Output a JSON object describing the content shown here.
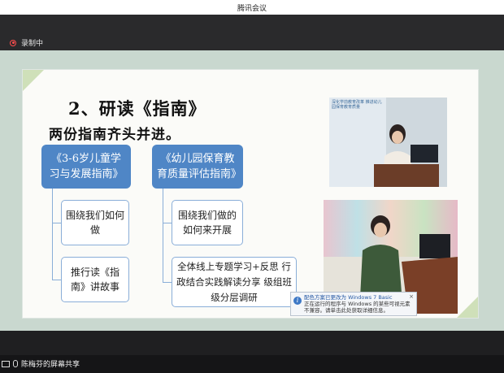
{
  "window": {
    "title": "腾讯会议"
  },
  "recording": {
    "label": "录制中"
  },
  "slide": {
    "heading": "2、研读《指南》",
    "subheading": "两份指南齐头并进。",
    "guides": [
      {
        "title": "《3-6岁儿童学习与发展指南》"
      },
      {
        "title": "《幼儿园保育教育质量评估指南》"
      }
    ],
    "left_items": [
      "围绕我们如何做",
      "推行读《指南》讲故事"
    ],
    "right_items": [
      "围绕我们做的如何来开展",
      "全体线上专题学习+反思 行政结合实践解读分享 级组班级分层调研"
    ],
    "banner_text": "深化学前教育改革 推进幼儿园保育教育质量"
  },
  "notice": {
    "icon": "info-icon",
    "line1": "配色方案已更改为 Windows 7 Basic",
    "line2": "正在运行的程序与 Windows 的某些可视元素不兼容。请单击此处获取详细信息。",
    "close": "×"
  },
  "mini_toolbar": {
    "icons": [
      "camera-icon",
      "mic-icon",
      "help-icon"
    ]
  },
  "footer": {
    "share_label": "陈梅芬的屏幕共享"
  },
  "colors": {
    "guide_box": "#4f86c6",
    "item_border": "#8aaed8",
    "slide_bg": "#c9d8cf",
    "corner": "#cfe0b9"
  }
}
